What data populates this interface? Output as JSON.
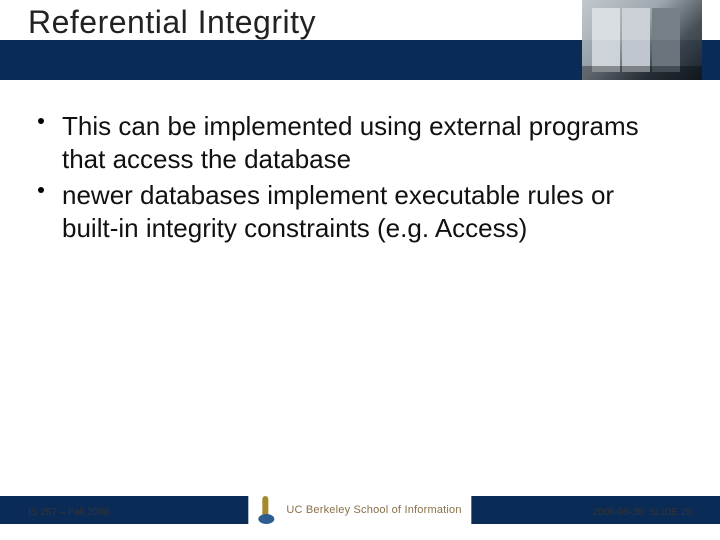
{
  "title": "Referential Integrity",
  "bullets": [
    "This can be implemented using external programs that access the database",
    "newer databases implement executable rules or built-in integrity constraints (e.g. Access)"
  ],
  "footer": {
    "left": "IS 257 – Fall 2008",
    "logo_text": "UC Berkeley School of Information",
    "date": "2008-09-30",
    "slide_label": "SLIDE",
    "slide_number": "25"
  }
}
